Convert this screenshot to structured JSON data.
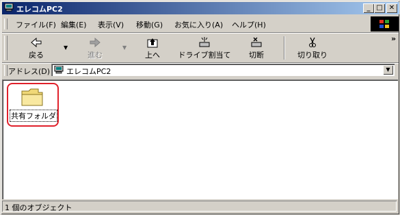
{
  "window": {
    "title": "エレコムPC2"
  },
  "title_buttons": {
    "minimize": "_",
    "maximize": "□",
    "close": "✕"
  },
  "menu": [
    {
      "label": "ファイル(F)"
    },
    {
      "label": "編集(E)"
    },
    {
      "label": "表示(V)"
    },
    {
      "label": "移動(G)"
    },
    {
      "label": "お気に入り(A)"
    },
    {
      "label": "ヘルプ(H)"
    }
  ],
  "toolbar": {
    "back": {
      "label": "戻る",
      "icon": "back-arrow-icon"
    },
    "forward": {
      "label": "進む",
      "icon": "forward-arrow-icon",
      "disabled": true
    },
    "up": {
      "label": "上へ",
      "icon": "up-folder-icon"
    },
    "map_drive": {
      "label": "ドライブ割当て",
      "icon": "map-drive-icon"
    },
    "disconnect": {
      "label": "切断",
      "icon": "disconnect-drive-icon"
    },
    "cut": {
      "label": "切り取り",
      "icon": "scissors-icon"
    },
    "more": "»"
  },
  "address": {
    "label": "アドレス(D)",
    "value": "エレコムPC2",
    "icon": "computer-icon"
  },
  "content": {
    "items": [
      {
        "label": "共有フォルダ",
        "icon": "folder-icon",
        "highlighted": true
      }
    ]
  },
  "status": {
    "text": "1 個のオブジェクト"
  },
  "colors": {
    "titlebar_start": "#0a246a",
    "titlebar_end": "#a6caf0",
    "highlight": "#e0202a",
    "face": "#d4d0c8"
  }
}
